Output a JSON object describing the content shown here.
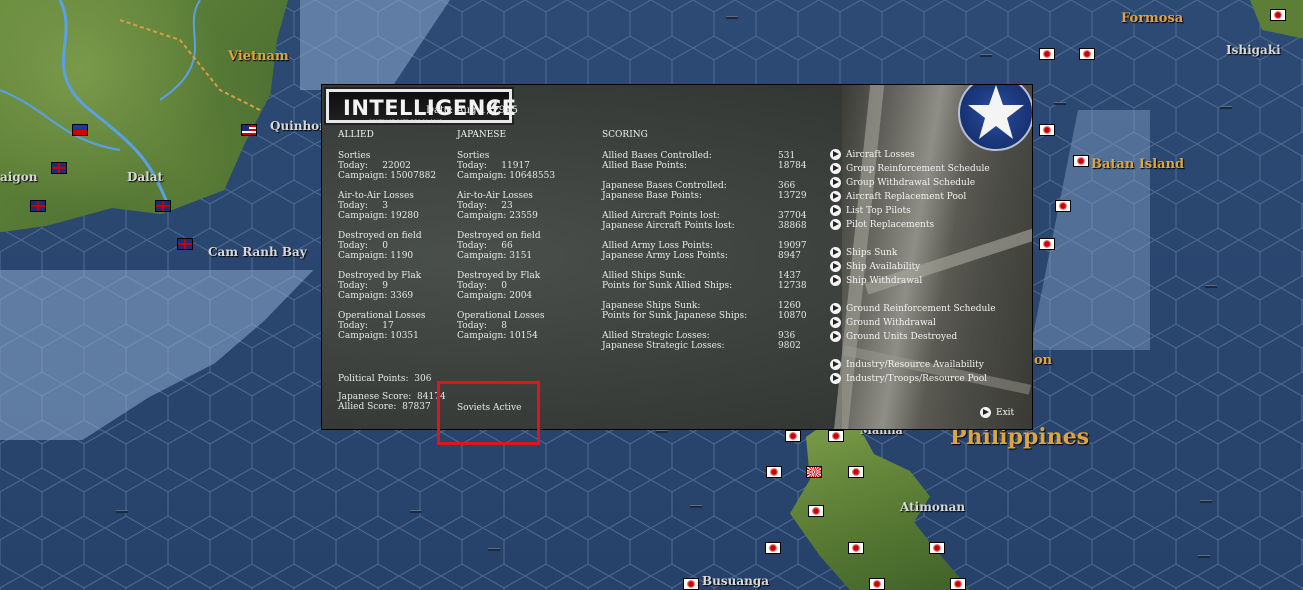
{
  "map": {
    "labels": {
      "vietnam": "Vietnam",
      "quinhon": "Quinhon",
      "dalat": "Dalat",
      "saigon": "aigon",
      "cam_ranh_bay": "Cam Ranh Bay",
      "formosa": "Formosa",
      "ishigaki": "Ishigaki",
      "batan_island": "Batan Island",
      "philippines": "Philippines",
      "manila": "Manila",
      "atimonan": "Atimonan",
      "busuanga": "Busuanga",
      "partial_on": "on"
    }
  },
  "panel": {
    "logo_title": "INTELLIGENCE",
    "logo_subtitle": "CONTRACT DATE DEC 31 1942",
    "date": "Date: Aug 1, 1945",
    "headers": {
      "allied": "ALLIED",
      "japanese": "JAPANESE",
      "scoring": "SCORING"
    },
    "allied": {
      "sorties_title": "Sorties",
      "sorties_today": "Today:     22002",
      "sorties_campaign": "Campaign: 15007882",
      "a2a_title": "Air-to-Air Losses",
      "a2a_today": "Today:     3",
      "a2a_campaign": "Campaign: 19280",
      "field_title": "Destroyed on field",
      "field_today": "Today:     0",
      "field_campaign": "Campaign: 1190",
      "flak_title": "Destroyed by Flak",
      "flak_today": "Today:     9",
      "flak_campaign": "Campaign: 3369",
      "op_title": "Operational Losses",
      "op_today": "Today:     17",
      "op_campaign": "Campaign: 10351"
    },
    "japanese": {
      "sorties_title": "Sorties",
      "sorties_today": "Today:     11917",
      "sorties_campaign": "Campaign: 10648553",
      "a2a_title": "Air-to-Air Losses",
      "a2a_today": "Today:     23",
      "a2a_campaign": "Campaign: 23559",
      "field_title": "Destroyed on field",
      "field_today": "Today:     66",
      "field_campaign": "Campaign: 3151",
      "flak_title": "Destroyed by Flak",
      "flak_today": "Today:     0",
      "flak_campaign": "Campaign: 2004",
      "op_title": "Operational Losses",
      "op_today": "Today:     8",
      "op_campaign": "Campaign: 10154"
    },
    "scoring": [
      {
        "label": "Allied Bases Controlled:",
        "value": "531"
      },
      {
        "label": "Allied Base Points:",
        "value": "18784"
      },
      {
        "label": "Japanese Bases Controlled:",
        "value": "366"
      },
      {
        "label": "Japanese Base Points:",
        "value": "13729"
      },
      {
        "label": "Allied Aircraft Points lost:",
        "value": "37704"
      },
      {
        "label": "Japanese Aircraft Points lost:",
        "value": "38868"
      },
      {
        "label": "Allied Army Loss Points:",
        "value": "19097"
      },
      {
        "label": "Japanese Army Loss Points:",
        "value": "8947"
      },
      {
        "label": "Allied Ships Sunk:",
        "value": "1437"
      },
      {
        "label": "Points for Sunk Allied Ships:",
        "value": "12738"
      },
      {
        "label": "Japanese Ships Sunk:",
        "value": "1260"
      },
      {
        "label": "Points for Sunk Japanese Ships:",
        "value": "10870"
      },
      {
        "label": "Allied Strategic Losses:",
        "value": "936"
      },
      {
        "label": "Japanese Strategic Losses:",
        "value": "9802"
      }
    ],
    "political_points": "Political Points:  306",
    "japanese_score": "Japanese Score:  84174",
    "allied_score": "Allied Score:  87837",
    "soviets": "Soviets Active",
    "menu": [
      "Aircraft Losses",
      "Group Reinforcement Schedule",
      "Group Withdrawal Schedule",
      "Aircraft Replacement Pool",
      "List Top Pilots",
      "Pilot Replacements",
      "Ships Sunk",
      "Ship Availability",
      "Ship Withdrawal",
      "Ground Reinforcement Schedule",
      "Ground Withdrawal",
      "Ground Units Destroyed",
      "Industry/Resource Availability",
      "Industry/Troops/Resource Pool"
    ],
    "exit": "Exit"
  },
  "colors": {
    "ocean": "#2c4a74",
    "panel_bg": "#3a3e3a",
    "highlight_box": "#e0151b",
    "map_label_gold": "#e0a53a"
  }
}
